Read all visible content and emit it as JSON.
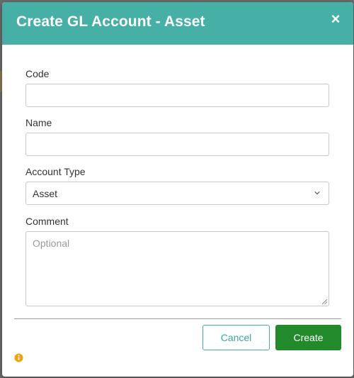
{
  "dialog": {
    "title": "Create GL Account - Asset",
    "close_glyph": "×"
  },
  "form": {
    "code": {
      "label": "Code",
      "value": ""
    },
    "name": {
      "label": "Name",
      "value": ""
    },
    "account_type": {
      "label": "Account Type",
      "value": "Asset"
    },
    "comment": {
      "label": "Comment",
      "placeholder": "Optional",
      "value": ""
    }
  },
  "footer": {
    "cancel_label": "Cancel",
    "create_label": "Create"
  },
  "icons": {
    "close": "close-icon",
    "chevron": "chevron-down-icon",
    "info": "info-icon",
    "resize": "resize-grip-icon"
  },
  "colors": {
    "header": "#46b0a6",
    "primary_button": "#238a2c",
    "cancel_border": "#46b0a6",
    "info": "#f0a30a"
  }
}
